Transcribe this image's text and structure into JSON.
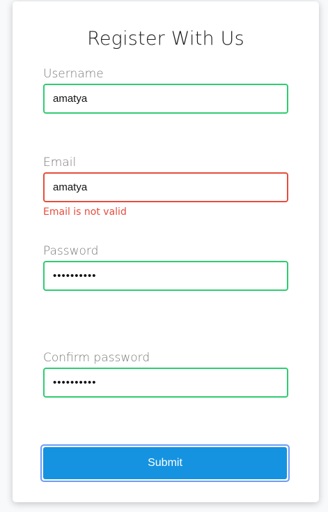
{
  "form": {
    "title": "Register With Us",
    "username": {
      "label": "Username",
      "value": "amatya",
      "status": "valid"
    },
    "email": {
      "label": "Email",
      "value": "amatya",
      "status": "invalid",
      "error": "Email is not valid"
    },
    "password": {
      "label": "Password",
      "value": "••••••••••",
      "status": "valid"
    },
    "confirm_password": {
      "label": "Confirm password",
      "value": "••••••••••",
      "status": "valid"
    },
    "submit_label": "Submit"
  },
  "colors": {
    "valid_border": "#2ecc71",
    "error_border": "#e74c3c",
    "submit_bg": "#1593e0",
    "focus_ring": "#6d9cf7"
  }
}
